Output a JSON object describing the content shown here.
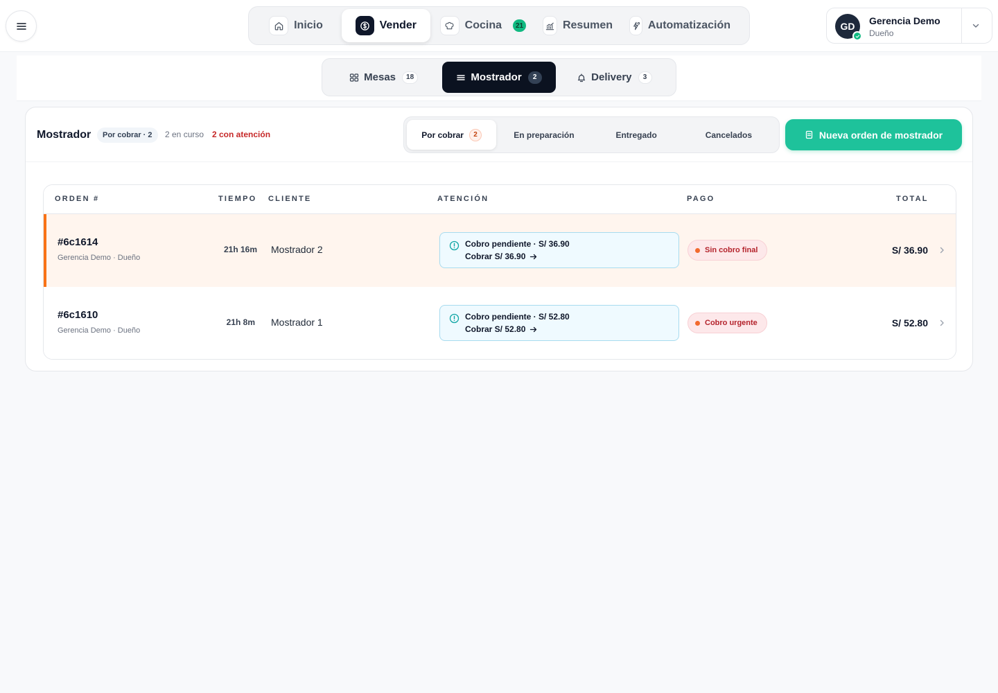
{
  "header": {
    "menu_icon": "hamburger-icon",
    "nav": [
      {
        "label": "Inicio",
        "icon": "home-icon",
        "active": false
      },
      {
        "label": "Vender",
        "icon": "dollar-icon",
        "active": true
      },
      {
        "label": "Cocina",
        "icon": "chef-hat-icon",
        "badge": "21",
        "active": false
      },
      {
        "label": "Resumen",
        "icon": "chart-icon",
        "active": false
      },
      {
        "label": "Automatización",
        "icon": "automation-icon",
        "active": false
      }
    ],
    "user": {
      "initials": "GD",
      "name": "Gerencia Demo",
      "role": "Dueño"
    }
  },
  "subnav": [
    {
      "label": "Mesas",
      "count": "18",
      "icon": "grid-icon",
      "active": false
    },
    {
      "label": "Mostrador",
      "count": "2",
      "icon": "counter-icon",
      "active": true
    },
    {
      "label": "Delivery",
      "count": "3",
      "icon": "bell-icon",
      "active": false
    }
  ],
  "panel": {
    "title": "Mostrador",
    "chip": "Por cobrar · 2",
    "in_progress": "2 en curso",
    "attention": "2 con atención",
    "filters": [
      {
        "label": "Por cobrar",
        "count": "2",
        "active": true
      },
      {
        "label": "En preparación",
        "active": false
      },
      {
        "label": "Entregado",
        "active": false
      },
      {
        "label": "Cancelados",
        "active": false
      }
    ],
    "new_button": "Nueva orden de mostrador"
  },
  "table": {
    "columns": [
      "ORDEN #",
      "TIEMPO",
      "CLIENTE",
      "ATENCIÓN",
      "PAGO",
      "TOTAL"
    ],
    "rows": [
      {
        "id": "#6c1614",
        "staff": "Gerencia Demo · Dueño",
        "time": "21h 16m",
        "client": "Mostrador 2",
        "attention_line1": "Cobro pendiente · S/ 36.90",
        "attention_line2": "Cobrar S/ 36.90",
        "payment": "Sin cobro final",
        "total": "S/ 36.90",
        "highlight": true
      },
      {
        "id": "#6c1610",
        "staff": "Gerencia Demo · Dueño",
        "time": "21h 8m",
        "client": "Mostrador 1",
        "attention_line1": "Cobro pendiente · S/ 52.80",
        "attention_line2": "Cobrar S/ 52.80",
        "payment": "Cobro urgente",
        "total": "S/ 52.80",
        "highlight": false
      }
    ]
  },
  "colors": {
    "accent": "#1ec29b",
    "dark": "#0b1220",
    "alert_row": "#fff5ee",
    "alert_border": "#f97316",
    "attention_text": "#c62828"
  }
}
